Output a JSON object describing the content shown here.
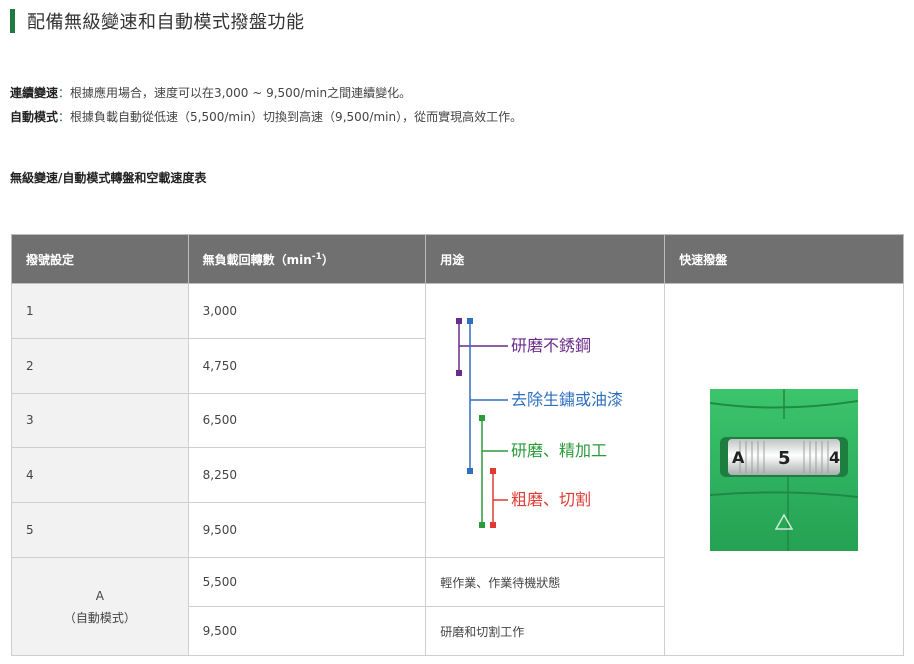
{
  "heading": "配備無級變速和自動模式撥盤功能",
  "desc1": {
    "label": "連續變速",
    "colon": "：",
    "text": "根據應用場合，速度可以在3,000 ~ 9,500/min之間連續變化。"
  },
  "desc2": {
    "label": "自動模式",
    "colon": "：",
    "text": "根據負載自動從低速（5,500/min）切換到高速（9,500/min），從而實現高效工作。"
  },
  "table_title": "無級變速/自動模式轉盤和空載速度表",
  "table": {
    "headers": {
      "setting": "撥號設定",
      "speed_prefix": "無負載回轉數（min",
      "speed_sup": "-1",
      "speed_suffix": "）",
      "use": "用途",
      "dial": "快速撥盤"
    },
    "rows": [
      {
        "setting": "1",
        "speed": "3,000"
      },
      {
        "setting": "2",
        "speed": "4,750"
      },
      {
        "setting": "3",
        "speed": "6,500"
      },
      {
        "setting": "4",
        "speed": "8,250"
      },
      {
        "setting": "5",
        "speed": "9,500"
      }
    ],
    "auto": {
      "setting_line1": "A",
      "setting_line2": "（自動模式）",
      "rows": [
        {
          "speed": "5,500",
          "use": "輕作業、作業待機狀態"
        },
        {
          "speed": "9,500",
          "use": "研磨和切割工作"
        }
      ]
    }
  },
  "use_diagram": {
    "labels": [
      {
        "text": "研磨不銹鋼",
        "color": "#6a2c8c"
      },
      {
        "text": "去除生鏽或油漆",
        "color": "#2e6fbf"
      },
      {
        "text": "研磨、精加工",
        "color": "#2a9a3a"
      },
      {
        "text": "粗磨、切割",
        "color": "#e03a33"
      }
    ]
  },
  "dial_image": {
    "left_mark": "A",
    "center": "5",
    "right_mark": "4",
    "body_color": "#2fb360"
  }
}
